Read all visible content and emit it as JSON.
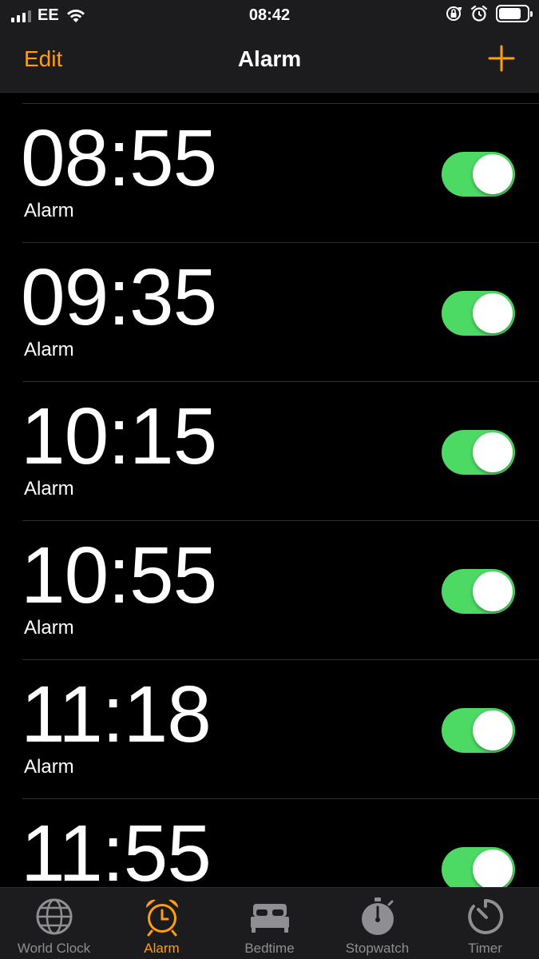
{
  "status_bar": {
    "carrier": "EE",
    "time": "08:42",
    "icons": [
      "signal-icon",
      "wifi-icon",
      "rotation-lock-icon",
      "alarm-icon",
      "battery-icon"
    ]
  },
  "nav": {
    "edit_label": "Edit",
    "title": "Alarm",
    "add_icon": "plus-icon"
  },
  "alarms": [
    {
      "time": "08:55",
      "label": "Alarm",
      "enabled": true
    },
    {
      "time": "09:35",
      "label": "Alarm",
      "enabled": true
    },
    {
      "time": "10:15",
      "label": "Alarm",
      "enabled": true
    },
    {
      "time": "10:55",
      "label": "Alarm",
      "enabled": true
    },
    {
      "time": "11:18",
      "label": "Alarm",
      "enabled": true
    },
    {
      "time": "11:55",
      "label": "",
      "enabled": true
    }
  ],
  "tabs": [
    {
      "label": "World Clock",
      "icon": "globe-icon",
      "active": false
    },
    {
      "label": "Alarm",
      "icon": "alarm-clock-icon",
      "active": true
    },
    {
      "label": "Bedtime",
      "icon": "bed-icon",
      "active": false
    },
    {
      "label": "Stopwatch",
      "icon": "stopwatch-icon",
      "active": false
    },
    {
      "label": "Timer",
      "icon": "timer-icon",
      "active": false
    }
  ],
  "colors": {
    "accent": "#ff9f0a",
    "toggle_on": "#4cd964",
    "background": "#000000",
    "bar_background": "#1c1c1e",
    "inactive_tab": "#8e8e93"
  }
}
